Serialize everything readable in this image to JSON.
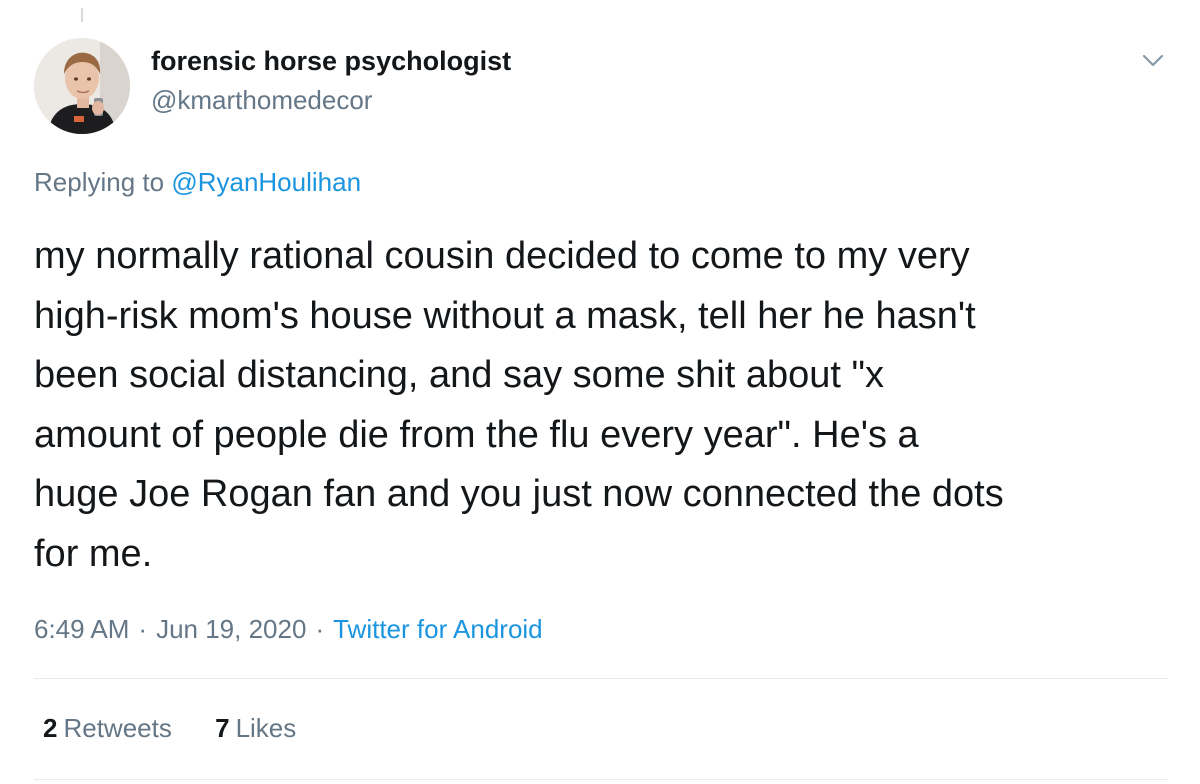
{
  "author": {
    "name": "forensic horse psychologist",
    "handle": "@kmarthomedecor"
  },
  "reply": {
    "prefix": "Replying to",
    "mention": "@RyanHoulihan"
  },
  "tweet": {
    "text": "my normally rational cousin decided to come to my very\nhigh-risk mom's house without a mask, tell her he hasn't\nbeen social distancing, and say some shit about \"x\namount of people die from the flu every year\". He's a\nhuge Joe Rogan fan and you just now connected the dots\nfor me."
  },
  "meta": {
    "time": "6:49 AM",
    "separator": "·",
    "date": "Jun 19, 2020",
    "source": "Twitter for Android"
  },
  "stats": {
    "retweets_count": "2",
    "retweets_label": "Retweets",
    "likes_count": "7",
    "likes_label": "Likes"
  },
  "icons": {
    "menu": "chevron-down-icon"
  },
  "colors": {
    "link": "#1b95e0",
    "secondary_text": "#657786",
    "primary_text": "#14171a",
    "divider": "#e6ecf0"
  }
}
